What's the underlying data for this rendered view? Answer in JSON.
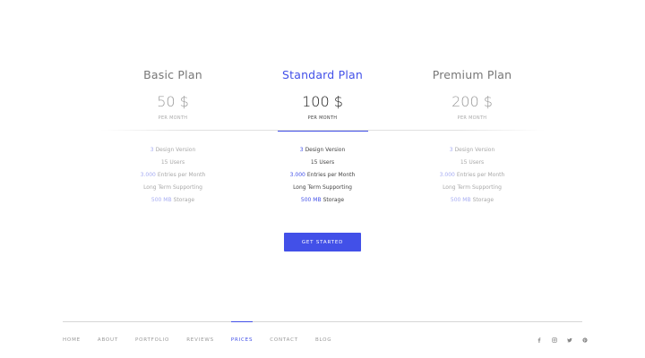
{
  "plans": [
    {
      "title": "Basic Plan",
      "price": "50 $",
      "period": "PER MONTH",
      "active": false
    },
    {
      "title": "Standard Plan",
      "price": "100 $",
      "period": "PER MONTH",
      "active": true
    },
    {
      "title": "Premium Plan",
      "price": "200 $",
      "period": "PER MONTH",
      "active": false
    }
  ],
  "features": [
    {
      "num": "3",
      "text": "Design Version"
    },
    {
      "num": "",
      "text": "15 Users"
    },
    {
      "num": "3.000",
      "text": "Entries per Month"
    },
    {
      "num": "",
      "text": "Long Term Supporting"
    },
    {
      "num": "500 MB",
      "text": "Storage"
    }
  ],
  "cta": {
    "label": "GET STARTED"
  },
  "nav": [
    {
      "label": "HOME",
      "active": false
    },
    {
      "label": "ABOUT",
      "active": false
    },
    {
      "label": "PORTFOLIO",
      "active": false
    },
    {
      "label": "REVIEWS",
      "active": false
    },
    {
      "label": "PRICES",
      "active": true
    },
    {
      "label": "CONTACT",
      "active": false
    },
    {
      "label": "BLOG",
      "active": false
    }
  ],
  "social": [
    "facebook-icon",
    "instagram-icon",
    "twitter-icon",
    "pinterest-icon"
  ],
  "colors": {
    "accent": "#4250e8",
    "muted": "#a8a8a8"
  }
}
